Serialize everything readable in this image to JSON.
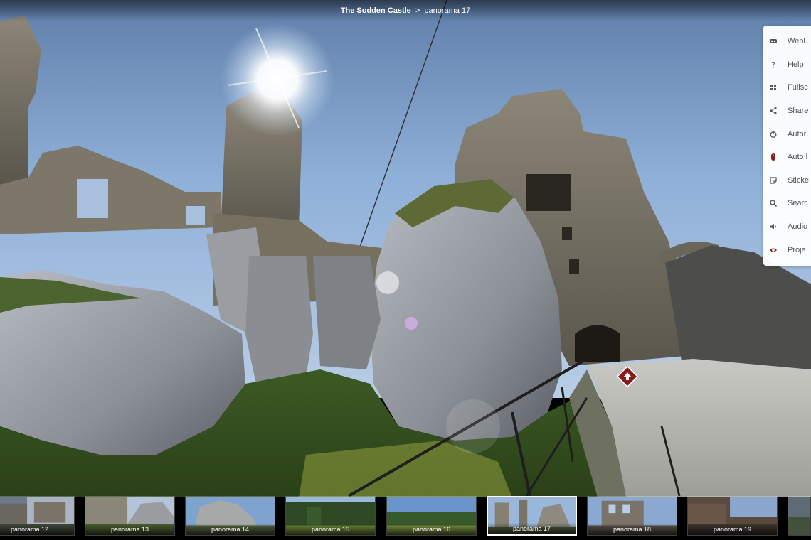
{
  "header": {
    "title": "The Sodden Castle",
    "separator": ">",
    "current": "panorama 17"
  },
  "menu": {
    "items": [
      {
        "label": "Webl",
        "icon": "vr-goggles-icon"
      },
      {
        "label": "Help",
        "icon": "question-icon"
      },
      {
        "label": "Fullsc",
        "icon": "fullscreen-icon"
      },
      {
        "label": "Share",
        "icon": "share-icon"
      },
      {
        "label": "Autor",
        "icon": "autorotate-icon"
      },
      {
        "label": "Auto l",
        "icon": "mouse-icon"
      },
      {
        "label": "Sticke",
        "icon": "sticker-icon"
      },
      {
        "label": "Searc",
        "icon": "search-icon"
      },
      {
        "label": "Audio",
        "icon": "speaker-icon"
      },
      {
        "label": "Proje",
        "icon": "eye-icon"
      }
    ]
  },
  "thumbnails": [
    {
      "label": "panorama 12",
      "active": false
    },
    {
      "label": "panorama 13",
      "active": false
    },
    {
      "label": "panorama 14",
      "active": false
    },
    {
      "label": "panorama 15",
      "active": false
    },
    {
      "label": "panorama 16",
      "active": false
    },
    {
      "label": "panorama 17",
      "active": true
    },
    {
      "label": "panorama 18",
      "active": false
    },
    {
      "label": "panorama 19",
      "active": false
    }
  ],
  "colors": {
    "hotspot": "#8b1a1a",
    "menu_text": "#555555",
    "menu_icon": "#555555"
  }
}
